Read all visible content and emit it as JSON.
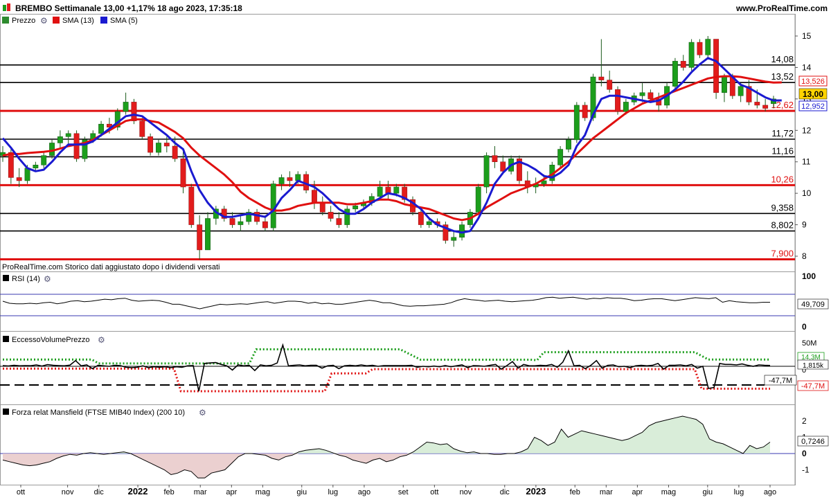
{
  "header": {
    "title": "BREMBO Settimanale 13,00 +1,17% 18 ago 2023, 17:35:18",
    "site": "www.ProRealTime.com"
  },
  "legend": [
    {
      "label": "Prezzo",
      "color": "#2e8b2e"
    },
    {
      "label": "SMA (13)",
      "color": "#e01010"
    },
    {
      "label": "SMA (5)",
      "color": "#1a1ad0"
    }
  ],
  "footnote": "ProRealTime.com  Storico dati aggiustato dopo i dividendi versati",
  "colors": {
    "up": "#1c9e1c",
    "down": "#e21c1c",
    "sma13": "#e01010",
    "sma5": "#1a1ad0"
  },
  "price_axis": {
    "ticks": [
      "15",
      "14",
      "13",
      "12",
      "11",
      "10",
      "9",
      "8"
    ],
    "last_price": "13,00",
    "sma13_value": "13,526",
    "sma5_value": "12,952"
  },
  "levels": [
    {
      "value": 14.08,
      "label": "14,08",
      "color": "#000000"
    },
    {
      "value": 13.52,
      "label": "13,52",
      "color": "#000000"
    },
    {
      "value": 12.62,
      "label": "12,62",
      "color": "#e01010"
    },
    {
      "value": 11.72,
      "label": "11,72",
      "color": "#000000"
    },
    {
      "value": 11.16,
      "label": "11,16",
      "color": "#000000"
    },
    {
      "value": 10.26,
      "label": "10,26",
      "color": "#e01010"
    },
    {
      "value": 9.358,
      "label": "9,358",
      "color": "#000000"
    },
    {
      "value": 8.802,
      "label": "8,802",
      "color": "#000000"
    },
    {
      "value": 7.9,
      "label": "7,900",
      "color": "#e01010"
    }
  ],
  "rsi": {
    "label": "RSI (14)",
    "ticks": [
      "100",
      "0"
    ],
    "value_label": "49,709",
    "values": [
      52,
      48,
      47,
      47,
      48,
      47,
      49,
      50,
      47,
      49,
      52,
      53,
      51,
      52,
      54,
      56,
      55,
      57,
      58,
      54,
      52,
      53,
      54,
      53,
      50,
      46,
      46,
      43,
      40,
      37,
      40,
      43,
      46,
      45,
      46,
      47,
      46,
      48,
      50,
      51,
      48,
      50,
      52,
      52,
      51,
      48,
      50,
      47,
      48,
      46,
      46,
      48,
      50,
      52,
      54,
      52,
      49,
      49,
      46,
      43,
      42,
      43,
      43,
      44,
      45,
      46,
      49,
      54,
      57,
      55,
      54,
      52,
      53,
      54,
      52,
      51,
      52,
      53,
      54,
      56,
      59,
      60,
      58,
      59,
      60,
      58,
      56,
      58,
      57,
      59,
      58,
      58,
      56,
      53,
      54,
      56,
      57,
      57,
      55,
      53,
      55,
      57,
      59,
      58,
      57,
      59,
      50,
      53,
      51,
      50,
      49,
      49,
      50,
      50
    ]
  },
  "evp": {
    "label": "EccessoVolumePrezzo",
    "ticks": [
      "50M",
      "0"
    ],
    "upper_label": "14,3M",
    "value_label": "1,815k",
    "lower_black_label": "-47,7M",
    "lower_red_label": "-47,7M",
    "values": [
      1.5,
      0.8,
      2,
      1,
      1.5,
      1.2,
      3,
      0.5,
      3.5,
      2,
      1.5,
      1,
      2.5,
      12,
      1,
      3,
      -5,
      2,
      1,
      0,
      2,
      1.5,
      -2,
      -3,
      -2,
      1,
      -3,
      -1,
      -2,
      -1,
      -3,
      -1,
      -2,
      1,
      1.5,
      -53,
      6,
      7,
      8,
      4,
      1,
      -8,
      3,
      1,
      2,
      -9,
      3,
      1,
      2,
      7,
      45,
      1,
      2,
      3,
      1,
      2,
      2,
      -4,
      1,
      2,
      -5,
      1,
      2,
      1,
      3,
      1,
      2,
      0,
      1.5,
      1.5,
      1.5,
      1.5,
      1.5,
      2,
      -2,
      0,
      -1,
      0.5,
      -1,
      1.5,
      -1,
      1,
      3,
      -3,
      1.5,
      1,
      0,
      2,
      4,
      -6,
      1.5,
      10,
      -4,
      4,
      1,
      1,
      2,
      1.5,
      4,
      -2,
      9,
      33,
      1,
      2,
      -5,
      2,
      12,
      -4,
      2,
      3,
      -1,
      0,
      -3,
      1,
      2,
      1,
      2,
      6,
      -6,
      2,
      2,
      3,
      1,
      4,
      -4,
      0,
      -47,
      -45,
      6,
      4,
      4,
      3,
      5,
      2,
      0,
      3,
      2,
      1.8
    ],
    "upper_dotted": [
      [
        "idx",
        0,
        14.2
      ],
      [
        "idx",
        13,
        14.2
      ],
      [
        "idx",
        14,
        6
      ],
      [
        "idx",
        36,
        6
      ],
      [
        "idx",
        37,
        36
      ],
      [
        "idx",
        58,
        36
      ],
      [
        "idx",
        61,
        14
      ],
      [
        "idx",
        63,
        14
      ],
      [
        "idx",
        64,
        14
      ],
      [
        "idx",
        77,
        14
      ],
      [
        "idx",
        78,
        13
      ],
      [
        "idx",
        79,
        30
      ],
      [
        "idx",
        101,
        30
      ],
      [
        "idx",
        103,
        14.3
      ],
      [
        "idx",
        112,
        14.3
      ]
    ],
    "lower_dotted": [
      [
        "idx",
        0,
        -5
      ],
      [
        "idx",
        25,
        -5
      ],
      [
        "idx",
        26,
        -53
      ],
      [
        "idx",
        47,
        -53
      ],
      [
        "idx",
        48,
        -15
      ],
      [
        "idx",
        53,
        -15
      ],
      [
        "idx",
        54,
        -6
      ],
      [
        "idx",
        101,
        -6
      ],
      [
        "idx",
        102,
        -47.7
      ],
      [
        "idx",
        112,
        -47.7
      ]
    ]
  },
  "mansfield": {
    "label": "Forza relat Mansfield (FTSE MIB40 Index) (200 10)",
    "ticks": [
      "2",
      "1",
      "0",
      "-1"
    ],
    "value_label": "0,7246",
    "values": [
      -0.4,
      -0.5,
      -0.6,
      -0.7,
      -0.75,
      -0.7,
      -0.6,
      -0.5,
      -0.3,
      -0.15,
      -0.05,
      -0.1,
      0,
      0.05,
      0,
      -0.05,
      0,
      0.05,
      0.1,
      0,
      -0.2,
      -0.4,
      -0.6,
      -0.8,
      -1.0,
      -1.3,
      -1.2,
      -1.0,
      -1.1,
      -1.5,
      -1.5,
      -1.2,
      -1.1,
      -1.0,
      -0.6,
      -0.2,
      0,
      0,
      -0.05,
      -0.1,
      -0.3,
      -0.4,
      -0.2,
      -0.1,
      0.1,
      0.2,
      0.25,
      0.3,
      0.2,
      0.05,
      -0.1,
      -0.2,
      -0.4,
      -0.5,
      -0.6,
      -0.4,
      -0.3,
      -0.5,
      -0.4,
      -0.2,
      -0.1,
      0.1,
      0.4,
      0.7,
      0.65,
      0.55,
      0.6,
      0.3,
      0.15,
      0.05,
      0.1,
      0,
      0,
      -0.05,
      -0.05,
      0,
      0,
      0.1,
      0.3,
      1.0,
      0.8,
      0.5,
      0.7,
      1.5,
      1.0,
      1.2,
      1.4,
      1.3,
      1.2,
      1.1,
      1.0,
      0.9,
      0.8,
      0.9,
      1.1,
      1.3,
      1.7,
      1.9,
      2.0,
      2.1,
      2.2,
      2.3,
      2.2,
      2.1,
      1.8,
      0.9,
      0.7,
      0.6,
      0.4,
      0.2,
      0,
      0.5,
      0.3,
      0.4,
      0.7
    ]
  },
  "x_axis": {
    "months": [
      {
        "label": "ott",
        "idx": 0
      },
      {
        "label": "nov",
        "idx": 6
      },
      {
        "label": "dic",
        "idx": 10
      },
      {
        "label": "2022",
        "idx": 15,
        "bold": true
      },
      {
        "label": "feb",
        "idx": 19
      },
      {
        "label": "mar",
        "idx": 23
      },
      {
        "label": "apr",
        "idx": 27
      },
      {
        "label": "mag",
        "idx": 31
      },
      {
        "label": "giu",
        "idx": 36
      },
      {
        "label": "lug",
        "idx": 40
      },
      {
        "label": "ago",
        "idx": 44
      },
      {
        "label": "set",
        "idx": 49
      },
      {
        "label": "ott",
        "idx": 53
      },
      {
        "label": "nov",
        "idx": 57
      },
      {
        "label": "dic",
        "idx": 62
      },
      {
        "label": "2023",
        "idx": 66,
        "bold": true
      },
      {
        "label": "feb",
        "idx": 71
      },
      {
        "label": "mar",
        "idx": 75
      },
      {
        "label": "apr",
        "idx": 79
      },
      {
        "label": "mag",
        "idx": 83
      },
      {
        "label": "giu",
        "idx": 88
      },
      {
        "label": "lug",
        "idx": 92
      },
      {
        "label": "ago",
        "idx": 96
      }
    ]
  },
  "chart_data": {
    "type": "candlestick",
    "title": "BREMBO Settimanale",
    "frequency": "weekly",
    "ylim": [
      7.7,
      15.3
    ],
    "ohlc": [
      [
        11.2,
        11.5,
        11.0,
        11.3
      ],
      [
        11.3,
        11.4,
        10.3,
        10.5
      ],
      [
        10.5,
        10.8,
        10.2,
        10.4
      ],
      [
        10.4,
        10.9,
        10.3,
        10.8
      ],
      [
        10.8,
        11.0,
        10.7,
        10.9
      ],
      [
        10.9,
        11.3,
        10.8,
        11.2
      ],
      [
        11.2,
        11.7,
        11.1,
        11.6
      ],
      [
        11.6,
        12.0,
        11.4,
        11.8
      ],
      [
        11.8,
        12.0,
        11.5,
        11.9
      ],
      [
        11.9,
        12.0,
        11.0,
        11.1
      ],
      [
        11.1,
        11.8,
        11.0,
        11.7
      ],
      [
        11.7,
        12.0,
        11.6,
        11.9
      ],
      [
        11.9,
        12.3,
        11.8,
        12.2
      ],
      [
        12.2,
        12.4,
        11.9,
        12.1
      ],
      [
        12.1,
        12.7,
        12.0,
        12.6
      ],
      [
        12.6,
        13.2,
        12.5,
        12.9
      ],
      [
        12.9,
        13.0,
        12.2,
        12.3
      ],
      [
        12.3,
        12.4,
        11.7,
        11.8
      ],
      [
        11.8,
        11.9,
        11.2,
        11.3
      ],
      [
        11.3,
        11.7,
        11.2,
        11.6
      ],
      [
        11.6,
        11.8,
        11.3,
        11.5
      ],
      [
        11.5,
        11.8,
        11.0,
        11.1
      ],
      [
        11.1,
        11.4,
        10.0,
        10.2
      ],
      [
        10.2,
        10.3,
        8.9,
        9.0
      ],
      [
        9.0,
        9.3,
        7.9,
        8.2
      ],
      [
        8.2,
        9.4,
        8.2,
        9.2
      ],
      [
        9.2,
        9.6,
        9.0,
        9.5
      ],
      [
        9.5,
        9.6,
        9.1,
        9.2
      ],
      [
        9.2,
        9.4,
        8.9,
        9.0
      ],
      [
        9.0,
        9.3,
        8.8,
        9.1
      ],
      [
        9.1,
        9.5,
        9.0,
        9.4
      ],
      [
        9.4,
        9.5,
        9.0,
        9.1
      ],
      [
        9.1,
        9.3,
        8.8,
        8.9
      ],
      [
        8.9,
        10.4,
        8.8,
        10.3
      ],
      [
        10.3,
        10.6,
        10.1,
        10.5
      ],
      [
        10.5,
        10.7,
        10.2,
        10.4
      ],
      [
        10.4,
        10.7,
        10.3,
        10.6
      ],
      [
        10.6,
        10.7,
        10.0,
        10.1
      ],
      [
        10.1,
        10.4,
        9.5,
        9.7
      ],
      [
        9.7,
        9.9,
        9.3,
        9.4
      ],
      [
        9.4,
        9.6,
        9.1,
        9.2
      ],
      [
        9.2,
        9.4,
        8.9,
        9.0
      ],
      [
        9.0,
        9.6,
        8.9,
        9.5
      ],
      [
        9.5,
        9.7,
        9.4,
        9.6
      ],
      [
        9.6,
        9.8,
        9.5,
        9.7
      ],
      [
        9.7,
        10.0,
        9.6,
        9.9
      ],
      [
        9.9,
        10.4,
        9.8,
        10.2
      ],
      [
        10.2,
        10.4,
        9.8,
        10.0
      ],
      [
        10.0,
        10.3,
        9.9,
        10.2
      ],
      [
        10.2,
        10.3,
        9.7,
        9.8
      ],
      [
        9.8,
        9.9,
        9.3,
        9.4
      ],
      [
        9.4,
        9.5,
        8.9,
        9.0
      ],
      [
        9.0,
        9.2,
        8.9,
        9.1
      ],
      [
        9.1,
        9.2,
        8.9,
        9.0
      ],
      [
        9.0,
        9.1,
        8.4,
        8.5
      ],
      [
        8.5,
        8.8,
        8.3,
        8.6
      ],
      [
        8.6,
        9.1,
        8.5,
        9.0
      ],
      [
        9.0,
        9.5,
        8.9,
        9.4
      ],
      [
        9.4,
        10.3,
        9.3,
        10.2
      ],
      [
        10.2,
        11.3,
        10.0,
        11.2
      ],
      [
        11.2,
        11.5,
        10.8,
        11.0
      ],
      [
        11.0,
        11.2,
        10.6,
        10.7
      ],
      [
        10.7,
        11.2,
        10.6,
        11.1
      ],
      [
        11.1,
        11.2,
        10.3,
        10.4
      ],
      [
        10.4,
        10.7,
        10.0,
        10.2
      ],
      [
        10.2,
        10.5,
        10.0,
        10.3
      ],
      [
        10.3,
        10.6,
        10.2,
        10.4
      ],
      [
        10.4,
        11.0,
        10.3,
        10.9
      ],
      [
        10.9,
        11.5,
        10.8,
        11.4
      ],
      [
        11.4,
        11.8,
        11.3,
        11.7
      ],
      [
        11.7,
        12.9,
        11.6,
        12.8
      ],
      [
        12.8,
        12.9,
        12.3,
        12.4
      ],
      [
        12.4,
        13.8,
        12.3,
        13.7
      ],
      [
        13.7,
        14.9,
        13.4,
        13.6
      ],
      [
        13.6,
        13.9,
        13.2,
        13.3
      ],
      [
        13.3,
        13.4,
        12.5,
        12.6
      ],
      [
        12.6,
        13.0,
        12.5,
        12.9
      ],
      [
        12.9,
        13.2,
        12.8,
        13.1
      ],
      [
        13.1,
        13.5,
        12.9,
        13.2
      ],
      [
        13.2,
        13.3,
        12.9,
        13.0
      ],
      [
        13.0,
        13.2,
        12.6,
        12.8
      ],
      [
        12.8,
        13.5,
        12.7,
        13.4
      ],
      [
        13.4,
        14.3,
        13.3,
        14.2
      ],
      [
        14.2,
        14.4,
        13.9,
        14.0
      ],
      [
        14.0,
        14.9,
        13.9,
        14.8
      ],
      [
        14.8,
        14.9,
        14.3,
        14.4
      ],
      [
        14.4,
        15.0,
        14.3,
        14.9
      ],
      [
        14.9,
        14.9,
        13.0,
        13.2
      ],
      [
        13.2,
        13.8,
        12.9,
        13.7
      ],
      [
        13.7,
        13.8,
        13.0,
        13.1
      ],
      [
        13.1,
        13.5,
        12.9,
        13.4
      ],
      [
        13.4,
        13.6,
        12.8,
        12.9
      ],
      [
        12.9,
        13.3,
        12.7,
        12.8
      ],
      [
        12.8,
        13.0,
        12.6,
        12.7
      ],
      [
        12.85,
        13.1,
        12.7,
        13.0
      ]
    ],
    "sma13": [
      11.2,
      11.25,
      11.25,
      11.28,
      11.3,
      11.32,
      11.35,
      11.42,
      11.5,
      11.55,
      11.6,
      11.7,
      11.85,
      12.0,
      12.15,
      12.3,
      12.35,
      12.35,
      12.3,
      12.25,
      12.1,
      11.95,
      11.75,
      11.45,
      11.2,
      11.0,
      10.8,
      10.6,
      10.35,
      10.05,
      9.85,
      9.7,
      9.55,
      9.45,
      9.45,
      9.5,
      9.6,
      9.65,
      9.7,
      9.7,
      9.7,
      9.7,
      9.65,
      9.65,
      9.7,
      9.75,
      9.8,
      9.8,
      9.75,
      9.65,
      9.6,
      9.55,
      9.5,
      9.4,
      9.3,
      9.2,
      9.15,
      9.2,
      9.35,
      9.55,
      9.7,
      9.85,
      10.0,
      10.1,
      10.2,
      10.3,
      10.45,
      10.6,
      10.8,
      11.0,
      11.25,
      11.5,
      11.75,
      11.95,
      12.15,
      12.35,
      12.55,
      12.7,
      12.85,
      12.95,
      13.05,
      13.15,
      13.25,
      13.35,
      13.45,
      13.55,
      13.65,
      13.7,
      13.72,
      13.72,
      13.7,
      13.65,
      13.6,
      13.55,
      13.52,
      13.526
    ],
    "sma5": [
      11.75,
      11.45,
      11.1,
      10.8,
      10.7,
      10.75,
      11.0,
      11.3,
      11.55,
      11.55,
      11.55,
      11.65,
      11.85,
      12.05,
      12.25,
      12.45,
      12.5,
      12.45,
      12.25,
      12.05,
      11.85,
      11.6,
      11.4,
      10.7,
      10.1,
      9.7,
      9.4,
      9.25,
      9.25,
      9.3,
      9.35,
      9.3,
      9.25,
      9.45,
      9.85,
      10.1,
      10.4,
      10.3,
      10.2,
      10.0,
      9.75,
      9.5,
      9.35,
      9.35,
      9.5,
      9.7,
      9.85,
      10.0,
      9.95,
      9.85,
      9.7,
      9.5,
      9.2,
      9.0,
      8.9,
      8.8,
      8.75,
      8.8,
      9.2,
      9.7,
      10.3,
      10.65,
      10.9,
      11.0,
      10.9,
      10.75,
      10.55,
      10.5,
      10.65,
      10.9,
      11.5,
      11.85,
      12.5,
      13.0,
      13.1,
      13.1,
      13.05,
      13.0,
      12.95,
      12.9,
      12.95,
      13.1,
      13.3,
      13.55,
      13.85,
      14.1,
      14.3,
      14.2,
      13.95,
      13.7,
      13.45,
      13.35,
      13.2,
      13.05,
      12.95,
      12.952
    ]
  }
}
